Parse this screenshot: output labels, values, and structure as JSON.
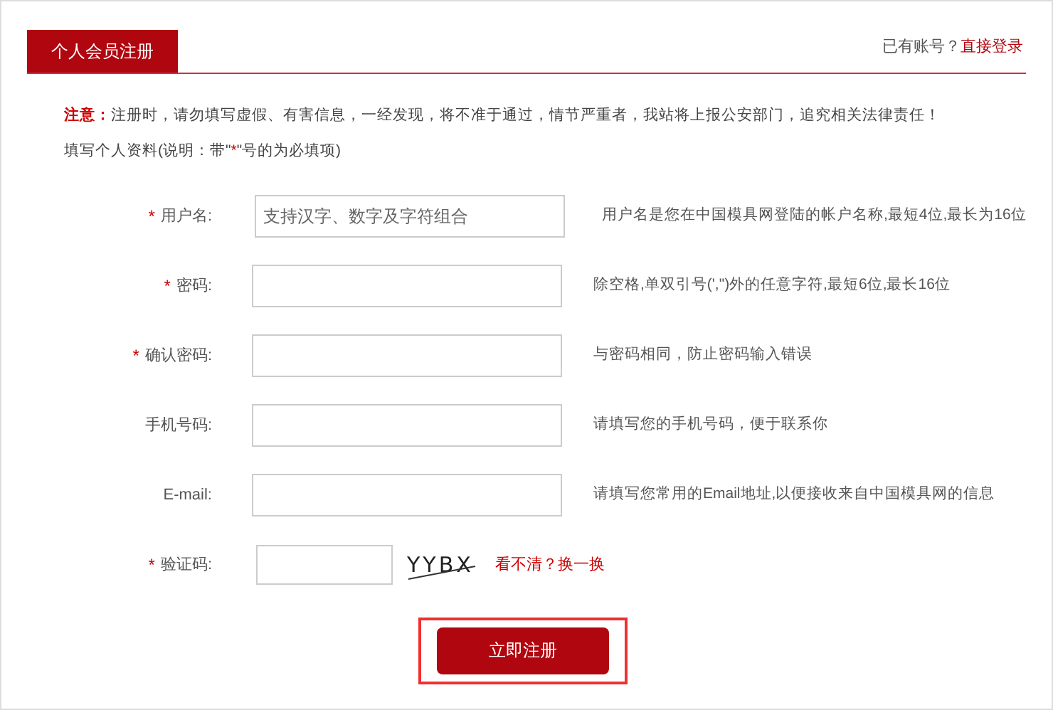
{
  "tab": {
    "label": "个人会员注册",
    "selected": true
  },
  "login_prompt": {
    "text": "已有账号？",
    "link": "直接登录"
  },
  "notice": {
    "label": "注意：",
    "text": "注册时，请勿填写虚假、有害信息，一经发现，将不准于通过，情节严重者，我站将上报公安部门，追究相关法律责任！"
  },
  "instructions": {
    "before": "填写个人资料(说明：带\"",
    "mark": "*",
    "after": "\"号的为必填项)"
  },
  "fields": [
    {
      "kind": "text",
      "label": "用户名:",
      "required": true,
      "placeholder": "支持汉字、数字及字符组合",
      "hint": "用户名是您在中国模具网登陆的帐户名称,最短4位,最长为16位"
    },
    {
      "kind": "text",
      "label": "密码:",
      "required": true,
      "hint": "除空格,单双引号(',\")外的任意字符,最短6位,最长16位"
    },
    {
      "kind": "text",
      "label": "确认密码:",
      "required": true,
      "hint": "与密码相同，防止密码输入错误"
    },
    {
      "kind": "text",
      "label": "手机号码:",
      "required": false,
      "hint": "请填写您的手机号码，便于联系你"
    },
    {
      "kind": "text",
      "label": "E-mail:",
      "required": false,
      "hint": "请填写您常用的Email地址,以便接收来自中国模具网的信息"
    },
    {
      "kind": "captcha",
      "label": "验证码:",
      "required": true,
      "captcha": "YYBX",
      "refresh_link": "看不清？换一换"
    }
  ],
  "submit": {
    "label": "立即注册",
    "highlighted": true
  }
}
